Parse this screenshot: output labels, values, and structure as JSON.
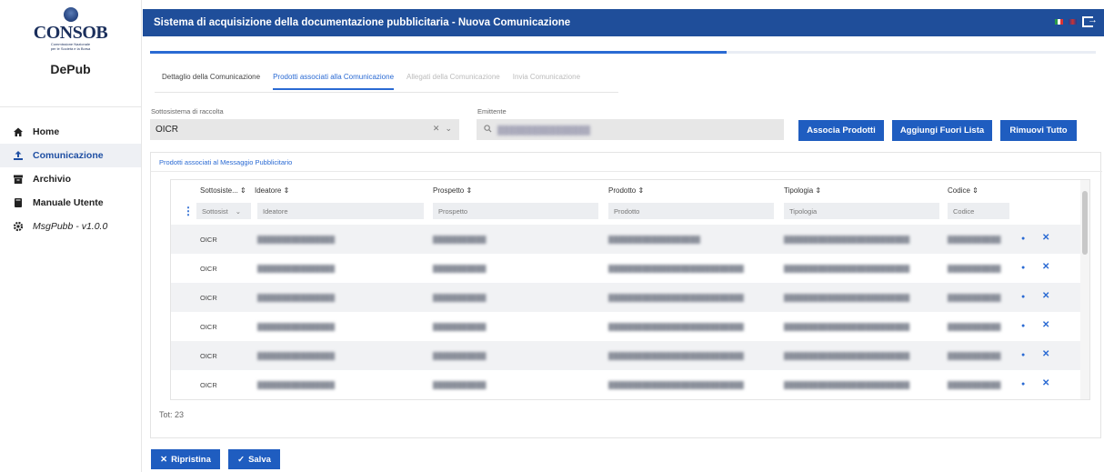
{
  "sidebar": {
    "logo_text": "CONSOB",
    "logo_sub1": "Commissione Nazionale",
    "logo_sub2": "per le Società e la Borsa",
    "app_name": "DePub",
    "items": [
      {
        "label": "Home",
        "icon": "home-icon"
      },
      {
        "label": "Comunicazione",
        "icon": "upload-icon"
      },
      {
        "label": "Archivio",
        "icon": "archive-icon"
      },
      {
        "label": "Manuale Utente",
        "icon": "book-icon"
      },
      {
        "label": "MsgPubb - v1.0.0",
        "icon": "gear-icon"
      }
    ],
    "active_index": 1
  },
  "header": {
    "title": "Sistema di acquisizione della documentazione pubblicitaria - Nuova Comunicazione"
  },
  "progress": {
    "value": 0.61
  },
  "tabs": [
    {
      "label": "Dettaglio della Comunicazione",
      "state": "normal"
    },
    {
      "label": "Prodotti associati alla Comunicazione",
      "state": "active"
    },
    {
      "label": "Allegati della Comunicazione",
      "state": "disabled"
    },
    {
      "label": "Invia Comunicazione",
      "state": "disabled"
    }
  ],
  "filters": {
    "sottosistema_label": "Sottosistema di raccolta",
    "sottosistema_value": "OICR",
    "emittente_label": "Emittente",
    "emittente_value": "████████████████"
  },
  "buttons": {
    "associa": "Associa Prodotti",
    "aggiungi": "Aggiungi Fuori Lista",
    "rimuovi": "Rimuovi Tutto"
  },
  "card": {
    "title": "Prodotti associati al Messaggio Pubblicitario"
  },
  "table": {
    "columns": [
      "Sottosiste... ⇕",
      "Ideatore ⇕",
      "Prospetto ⇕",
      "Prodotto ⇕",
      "Tipologia ⇕",
      "Codice ⇕"
    ],
    "filter_placeholders": [
      "Sottosist",
      "Ideatore",
      "Prospetto",
      "Prodotto",
      "Tipologia",
      "Codice"
    ],
    "rows": [
      {
        "sottosistema": "OICR",
        "ideatore": "████████████████",
        "prospetto": "███████████",
        "prodotto": "███████████████████",
        "tipologia": "██████████████████████████",
        "codice": "███████████"
      },
      {
        "sottosistema": "OICR",
        "ideatore": "████████████████",
        "prospetto": "███████████",
        "prodotto": "████████████████████████████",
        "tipologia": "██████████████████████████",
        "codice": "███████████"
      },
      {
        "sottosistema": "OICR",
        "ideatore": "████████████████",
        "prospetto": "███████████",
        "prodotto": "████████████████████████████",
        "tipologia": "██████████████████████████",
        "codice": "███████████"
      },
      {
        "sottosistema": "OICR",
        "ideatore": "████████████████",
        "prospetto": "███████████",
        "prodotto": "████████████████████████████",
        "tipologia": "██████████████████████████",
        "codice": "███████████"
      },
      {
        "sottosistema": "OICR",
        "ideatore": "████████████████",
        "prospetto": "███████████",
        "prodotto": "████████████████████████████",
        "tipologia": "██████████████████████████",
        "codice": "███████████"
      },
      {
        "sottosistema": "OICR",
        "ideatore": "████████████████",
        "prospetto": "███████████",
        "prodotto": "████████████████████████████",
        "tipologia": "██████████████████████████",
        "codice": "███████████"
      }
    ],
    "total_text": "Tot: 23"
  },
  "footer": {
    "ripristina": "Ripristina",
    "salva": "Salva"
  }
}
